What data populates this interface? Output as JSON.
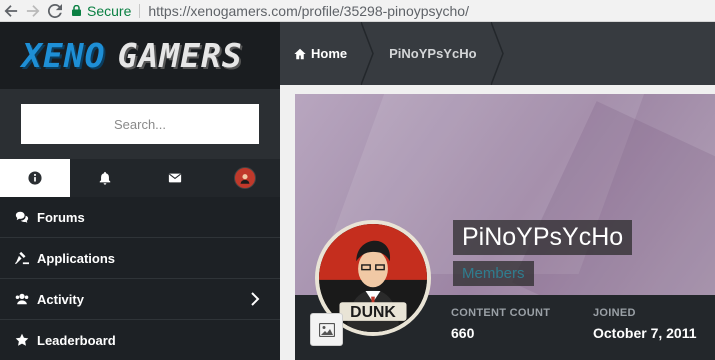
{
  "browser": {
    "secure_label": "Secure",
    "url": "https://xenogamers.com/profile/35298-pinoypsycho/",
    "icons": [
      "back-arrow-icon",
      "forward-arrow-icon",
      "reload-icon",
      "lock-icon"
    ]
  },
  "logo": {
    "part1": "XENO",
    "part2": "GAMERS"
  },
  "search": {
    "placeholder": "Search..."
  },
  "tabs": [
    {
      "icon": "info-icon",
      "active": true
    },
    {
      "icon": "bell-icon",
      "active": false
    },
    {
      "icon": "envelope-icon",
      "active": false
    },
    {
      "icon": "user-avatar-icon",
      "active": false
    }
  ],
  "menu": {
    "items": [
      {
        "label": "Forums",
        "icon": "comments-icon"
      },
      {
        "label": "Applications",
        "icon": "gavel-icon"
      },
      {
        "label": "Activity",
        "icon": "users-icon",
        "has_chevron": true
      },
      {
        "label": "Leaderboard",
        "icon": "star-icon"
      }
    ]
  },
  "breadcrumb": {
    "home": "Home",
    "current": "PiNoYPsYcHo"
  },
  "profile": {
    "name": "PiNoYPsYcHo",
    "group": "Members",
    "avatar_text": "DUNK",
    "stats": {
      "content_count_label": "CONTENT COUNT",
      "content_count": "660",
      "joined_label": "JOINED",
      "joined": "October 7, 2011"
    }
  },
  "colors": {
    "secure_green": "#0b8043",
    "sidebar_bg": "#1d2125",
    "breadcrumb_bg": "#373b40",
    "group_color": "#2f7d8f",
    "logo_blue": "#1e8fd6"
  }
}
